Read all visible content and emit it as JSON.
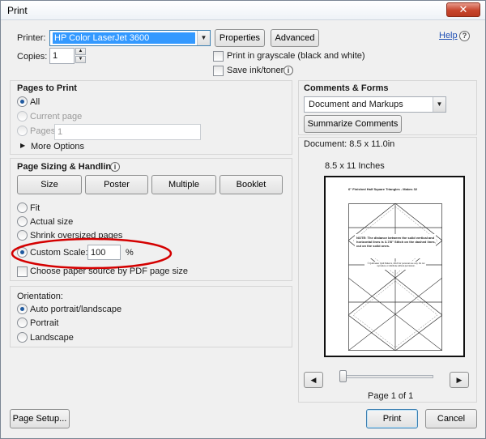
{
  "window": {
    "title": "Print",
    "close_glyph": "✕"
  },
  "top": {
    "printer_label": "Printer:",
    "printer_value": "HP Color LaserJet 3600",
    "properties_label": "Properties",
    "advanced_label": "Advanced",
    "help_label": "Help",
    "copies_label": "Copies:",
    "copies_value": "1",
    "grayscale_label": "Print in grayscale (black and white)",
    "save_ink_label": "Save ink/toner"
  },
  "pages_to_print": {
    "title": "Pages to Print",
    "all_label": "All",
    "current_label": "Current page",
    "pages_label": "Pages",
    "pages_value": "1",
    "more_options_label": "More Options"
  },
  "sizing": {
    "title": "Page Sizing & Handling",
    "tabs": [
      "Size",
      "Poster",
      "Multiple",
      "Booklet"
    ],
    "fit_label": "Fit",
    "actual_label": "Actual size",
    "shrink_label": "Shrink oversized pages",
    "custom_label": "Custom Scale:",
    "custom_value": "100",
    "percent_label": "%",
    "paper_source_label": "Choose paper source by PDF page size"
  },
  "orientation": {
    "title": "Orientation:",
    "auto_label": "Auto portrait/landscape",
    "portrait_label": "Portrait",
    "landscape_label": "Landscape"
  },
  "comments": {
    "title": "Comments & Forms",
    "select_value": "Document and Markups",
    "summarize_label": "Summarize Comments"
  },
  "preview": {
    "document_label": "Document: 8.5 x 11.0in",
    "paper_label": "8.5 x 11 Inches",
    "page_heading": "6\" Finished Half Square Triangles - Makes 32",
    "page_note": "NOTE: The distance between the solid vertical and horizontal lines is 3-7/8\" Stitch on the dashed lines, cut on the solid ones.",
    "page_copyright": "© Quiltmaker Quilt Patterns, 2013 For personal use only. Do not reproduce or distribute without permission.",
    "page_indicator": "Page 1 of 1",
    "prev_glyph": "◀",
    "next_glyph": "▶"
  },
  "bottom": {
    "page_setup_label": "Page Setup...",
    "print_label": "Print",
    "cancel_label": "Cancel"
  },
  "colors": {
    "accent": "#1f5aa0",
    "selection": "#3399ff",
    "highlight_ellipse": "#d40000"
  },
  "icons": [
    "close-icon",
    "help-icon",
    "info-icon",
    "chevron-down-icon",
    "triangle-right-icon",
    "arrow-left-icon",
    "arrow-right-icon"
  ]
}
